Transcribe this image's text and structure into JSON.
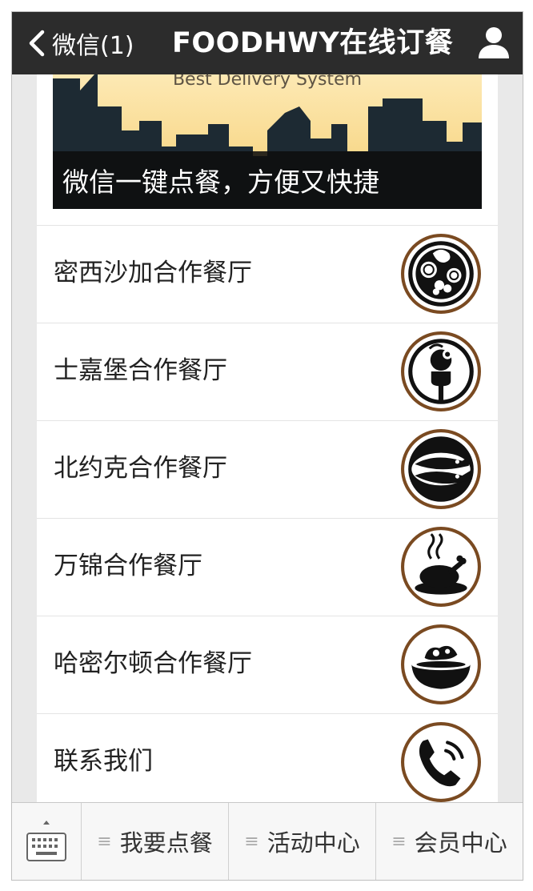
{
  "navbar": {
    "back_label": "微信(1)",
    "title": "FOODHWY在线订餐",
    "back_icon": "chevron-left-icon",
    "profile_icon": "user-icon",
    "background": "#2c2c2c"
  },
  "banner": {
    "tagline": "Best Delivery System",
    "caption": "微信一键点餐，方便又快捷"
  },
  "restaurants": [
    {
      "name": "密西沙加合作餐厅",
      "icon": "salad-plate-icon"
    },
    {
      "name": "士嘉堡合作餐厅",
      "icon": "fork-icon"
    },
    {
      "name": "北约克合作餐厅",
      "icon": "fish-plate-icon"
    },
    {
      "name": "万锦合作餐厅",
      "icon": "roast-chicken-icon"
    },
    {
      "name": "哈密尔顿合作餐厅",
      "icon": "soup-bowl-icon"
    },
    {
      "name": "联系我们",
      "icon": "phone-icon"
    }
  ],
  "tabbar": {
    "keyboard_icon": "keyboard-icon",
    "tabs": [
      {
        "label": "我要点餐"
      },
      {
        "label": "活动中心"
      },
      {
        "label": "会员中心"
      }
    ]
  },
  "colors": {
    "icon_ring": "#7a4a21",
    "divider": "#e4e4e4"
  }
}
